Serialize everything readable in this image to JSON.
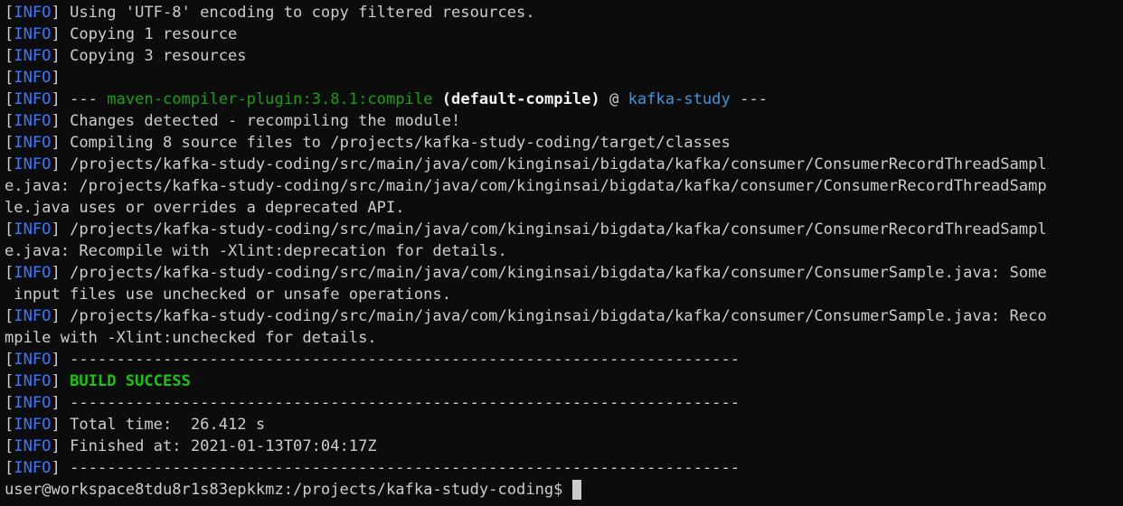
{
  "terminal": {
    "level_tag": "INFO",
    "lines": [
      "Using 'UTF-8' encoding to copy filtered resources.",
      "Copying 1 resource",
      "Copying 3 resources",
      "",
      {
        "prefix": "--- ",
        "plugin": "maven-compiler-plugin:3.8.1:compile",
        "execution": "(default-compile)",
        "at": " @ ",
        "project": "kafka-study",
        "suffix": " ---"
      },
      "Changes detected - recompiling the module!",
      "Compiling 8 source files to /projects/kafka-study-coding/target/classes",
      "/projects/kafka-study-coding/src/main/java/com/kinginsai/bigdata/kafka/consumer/ConsumerRecordThreadSampl",
      "e.java: /projects/kafka-study-coding/src/main/java/com/kinginsai/bigdata/kafka/consumer/ConsumerRecordThreadSamp",
      "le.java uses or overrides a deprecated API.",
      "/projects/kafka-study-coding/src/main/java/com/kinginsai/bigdata/kafka/consumer/ConsumerRecordThreadSampl",
      "e.java: Recompile with -Xlint:deprecation for details.",
      "/projects/kafka-study-coding/src/main/java/com/kinginsai/bigdata/kafka/consumer/ConsumerSample.java: Some",
      " input files use unchecked or unsafe operations.",
      "/projects/kafka-study-coding/src/main/java/com/kinginsai/bigdata/kafka/consumer/ConsumerSample.java: Reco",
      "mpile with -Xlint:unchecked for details.",
      "------------------------------------------------------------------------",
      "BUILD SUCCESS",
      "------------------------------------------------------------------------",
      "Total time:  26.412 s",
      "Finished at: 2021-01-13T07:04:17Z",
      "------------------------------------------------------------------------"
    ],
    "prompt": "user@workspace8tdu8r1s83epkkmz:/projects/kafka-study-coding$"
  },
  "colors": {
    "background": "#0c0c0c",
    "text": "#cccccc",
    "info_tag": "#3b78ff",
    "plugin": "#13a10e",
    "project": "#3a96dd",
    "success": "#16c60c"
  }
}
